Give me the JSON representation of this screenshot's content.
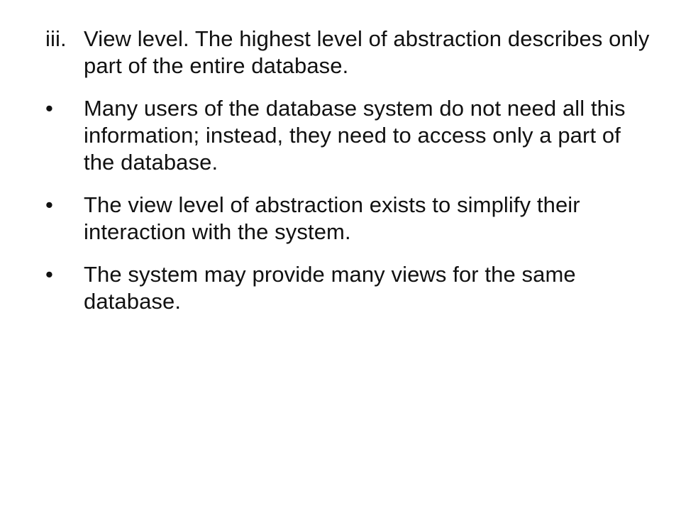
{
  "items": [
    {
      "type": "numbered",
      "marker": "iii.",
      "text": "View level. The highest level of abstraction describes only part of the entire database."
    },
    {
      "type": "bullet",
      "marker": "•",
      "text": "Many users of the database system do not need all this information; instead, they need to access only a part of the database."
    },
    {
      "type": "bullet",
      "marker": "•",
      "text": "The view level of abstraction exists to simplify their interaction with the system."
    },
    {
      "type": "bullet",
      "marker": "•",
      "text": "The system may provide many views for the same database."
    }
  ]
}
